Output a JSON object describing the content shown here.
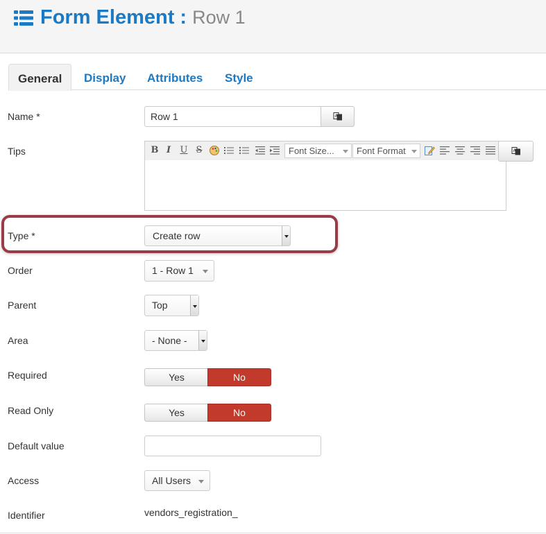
{
  "header": {
    "title": "Form Element :",
    "subtitle": "Row 1",
    "icon": "list-icon",
    "title_color": "#1b7ac5"
  },
  "tabs": [
    {
      "label": "General",
      "active": true
    },
    {
      "label": "Display",
      "active": false
    },
    {
      "label": "Attributes",
      "active": false
    },
    {
      "label": "Style",
      "active": false
    }
  ],
  "fields": {
    "name": {
      "label": "Name *",
      "value": "Row 1"
    },
    "tips": {
      "label": "Tips",
      "toolbar": {
        "buttons": [
          "bold-icon",
          "italic-icon",
          "underline-icon",
          "strikethrough-icon",
          "color-palette-icon",
          "ordered-list-icon",
          "unordered-list-icon",
          "outdent-icon",
          "indent-icon"
        ],
        "font_size": "Font Size...",
        "font_format": "Font Format",
        "align_buttons": [
          "edit-icon",
          "align-left-icon",
          "align-center-icon",
          "align-right-icon",
          "justify-icon"
        ]
      }
    },
    "type": {
      "label": "Type *",
      "value": "Create row"
    },
    "order": {
      "label": "Order",
      "value": "1 - Row 1"
    },
    "parent": {
      "label": "Parent",
      "value": "Top"
    },
    "area": {
      "label": "Area",
      "value": "- None -"
    },
    "required": {
      "label": "Required",
      "yes": "Yes",
      "no": "No",
      "selected": "No"
    },
    "read_only": {
      "label": "Read Only",
      "yes": "Yes",
      "no": "No",
      "selected": "No"
    },
    "default_value": {
      "label": "Default value",
      "value": ""
    },
    "access": {
      "label": "Access",
      "value": "All Users"
    },
    "identifier": {
      "label": "Identifier",
      "value": "vendors_registration_"
    }
  },
  "colors": {
    "accent": "#1b7ac5",
    "toggle_selected": "#c23a2c",
    "highlight_border": "#9a3c48"
  }
}
